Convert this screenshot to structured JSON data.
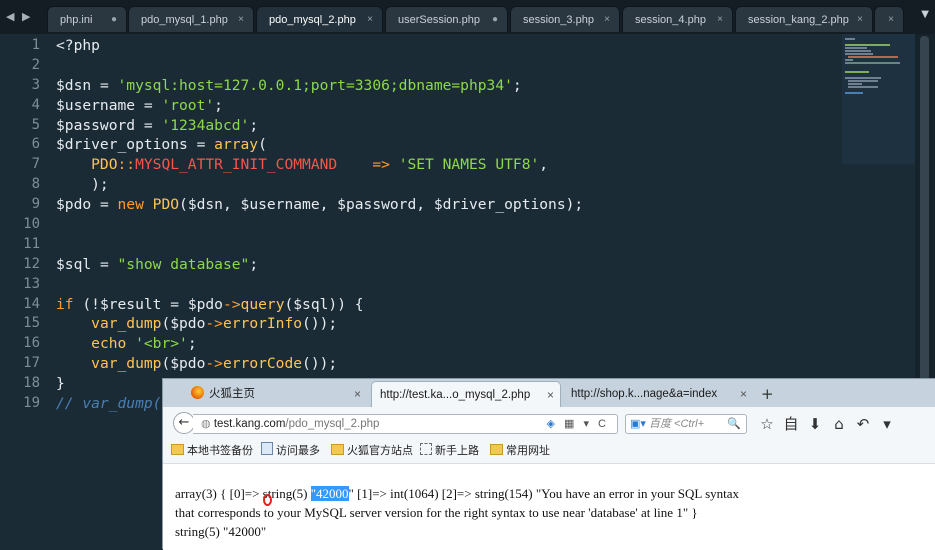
{
  "editor": {
    "nav_arrows": "◀ ▶",
    "tabs": [
      {
        "label": "php.ini",
        "close": "●"
      },
      {
        "label": "pdo_mysql_1.php",
        "close": "×"
      },
      {
        "label": "pdo_mysql_2.php",
        "close": "×"
      },
      {
        "label": "userSession.php",
        "close": "●"
      },
      {
        "label": "session_3.php",
        "close": "×"
      },
      {
        "label": "session_4.php",
        "close": "×"
      },
      {
        "label": "session_kang_2.php",
        "close": "×"
      },
      {
        "label": "",
        "close": "×"
      }
    ],
    "dropdown": "▼",
    "line_numbers": [
      "1",
      "2",
      "3",
      "4",
      "5",
      "6",
      "7",
      "8",
      "9",
      "10",
      "11",
      "12",
      "13",
      "14",
      "15",
      "16",
      "17",
      "18",
      "19"
    ],
    "lines": {
      "l1": [
        "<?php"
      ],
      "l3": [
        "$dsn",
        " = ",
        "'mysql:host=127.0.0.1;port=3306;dbname=php34'",
        ";"
      ],
      "l4": [
        "$username",
        " = ",
        "'root'",
        ";"
      ],
      "l5": [
        "$password",
        " = ",
        "'1234abcd'",
        ";"
      ],
      "l6": [
        "$driver_options",
        " = ",
        "array",
        "("
      ],
      "l7": [
        "    PDO",
        "::",
        "MYSQL_ATTR_INIT_COMMAND",
        "    => ",
        "'SET NAMES UTF8'",
        ","
      ],
      "l8": [
        "    );"
      ],
      "l9": [
        "$pdo",
        " = ",
        "new",
        " ",
        "PDO",
        "($dsn, $username, $password, $driver_options);"
      ],
      "l12": [
        "$sql",
        " = ",
        "\"show database\"",
        ";"
      ],
      "l14": [
        "if",
        " (!",
        "$result",
        " = ",
        "$pdo",
        "->",
        "query",
        "($sql)) {"
      ],
      "l15": [
        "    ",
        "var_dump",
        "($pdo",
        "->",
        "errorInfo",
        "());"
      ],
      "l16": [
        "    ",
        "echo",
        " ",
        "'<br>'",
        ";"
      ],
      "l17": [
        "    ",
        "var_dump",
        "($pdo",
        "->",
        "errorCode",
        "());"
      ],
      "l18": [
        "}"
      ],
      "l19": [
        "// var_dump("
      ]
    }
  },
  "browser": {
    "tabs": [
      {
        "label": "火狐主页",
        "close": "×"
      },
      {
        "label": "http://test.ka...o_mysql_2.php",
        "close": "×"
      },
      {
        "label": "http://shop.k...nage&a=index",
        "close": "×"
      }
    ],
    "new_tab": "+",
    "back": "←",
    "url_host": "test.kang.com",
    "url_path": "/pdo_mysql_2.php",
    "url_icons": "▾ C",
    "search_placeholder": "百度 <Ctrl+",
    "search_icon": "🔍",
    "nav_icons": [
      "☆",
      "自",
      "⬇",
      "⌂",
      "↶",
      "▾"
    ],
    "bookmarks": [
      "本地书签备份",
      "访问最多",
      "火狐官方站点",
      "新手上路",
      "常用网址"
    ],
    "output": {
      "line1_a": "array(3) { [",
      "line1_idx": "0",
      "line1_b": "]=> string(5) ",
      "line1_hl": "\"42000",
      "line1_c": "\" [1]=> int(1064) [2]=> string(154) \"You have an error in your SQL syntax",
      "line2": "that corresponds to your MySQL server version for the right syntax to use near 'database' at line 1\" }",
      "line3": "string(5) \"42000\""
    }
  }
}
